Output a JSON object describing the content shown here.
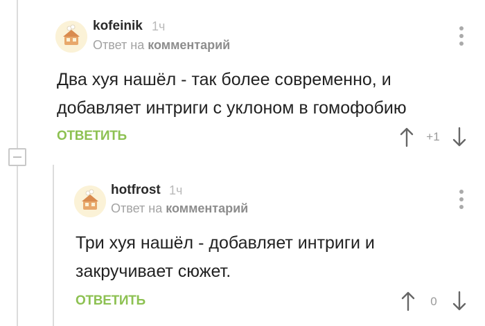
{
  "comments": [
    {
      "author": "kofeinik",
      "time": "1ч",
      "reply_prefix": "Ответ на",
      "reply_target": "комментарий",
      "text_line1": "Два хуя нашёл - так более современно, и",
      "text_line2": "добавляет интриги с уклоном в гомофобию",
      "reply_label": "ОТВЕТИТЬ",
      "rating": "+1"
    },
    {
      "author": "hotfrost",
      "time": "1ч",
      "reply_prefix": "Ответ на",
      "reply_target": "комментарий",
      "text_line1": "Три хуя нашёл - добавляет интриги и",
      "text_line2": "закручивает сюжет.",
      "reply_label": "ОТВЕТИТЬ",
      "rating": "0"
    }
  ],
  "icons": {
    "avatar": "default-avatar-icon",
    "menu": "more-vertical-icon",
    "upvote": "arrow-up-icon",
    "downvote": "arrow-down-icon",
    "collapse": "collapse-thread-icon"
  },
  "colors": {
    "accent": "#8dc152",
    "text": "#222222",
    "muted": "#a2a2a2",
    "thread_line": "#dcdcdc"
  }
}
